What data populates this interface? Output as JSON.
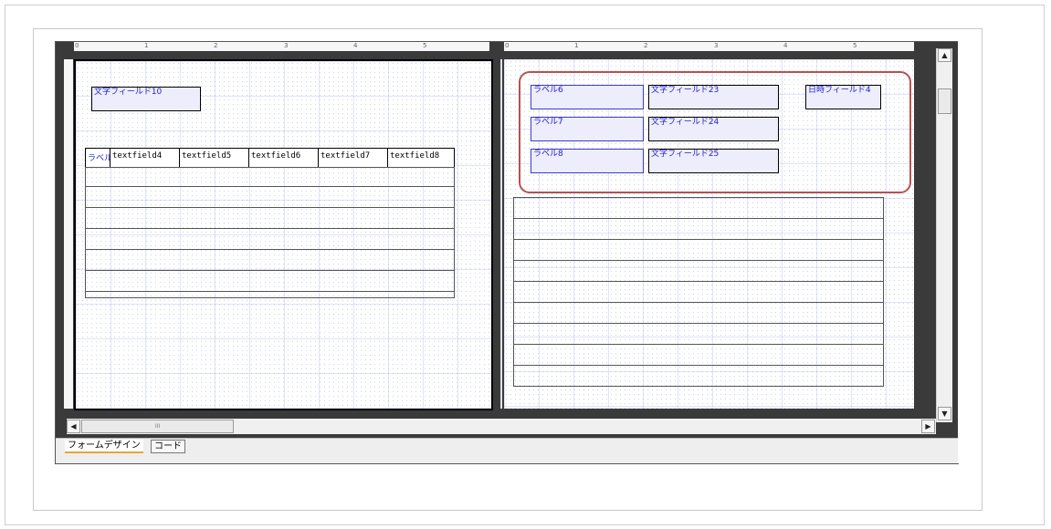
{
  "left_page": {
    "text_field": "文字フィールド10",
    "table_headers": [
      "ラベル",
      "textfield4",
      "textfield5",
      "textfield6",
      "textfield7",
      "textfield8"
    ]
  },
  "right_page": {
    "labels": [
      "ラベル6",
      "ラベル7",
      "ラベル8"
    ],
    "text_fields": [
      "文字フィールド23",
      "文字フィールド24",
      "文字フィールド25"
    ],
    "datetime_field": "日時フィールド4"
  },
  "ruler_numbers": [
    "0",
    "1",
    "2",
    "3",
    "4",
    "5"
  ],
  "scrollbar": {
    "up": "▲",
    "down": "▼",
    "left": "◀",
    "right": "▶",
    "grip": "III"
  },
  "tabs": {
    "design": "フォームデザイン",
    "code": "コード"
  },
  "colors": {
    "highlight": "#b5524f",
    "field_text": "#2222cc",
    "tab_accent": "#e6a43a"
  }
}
